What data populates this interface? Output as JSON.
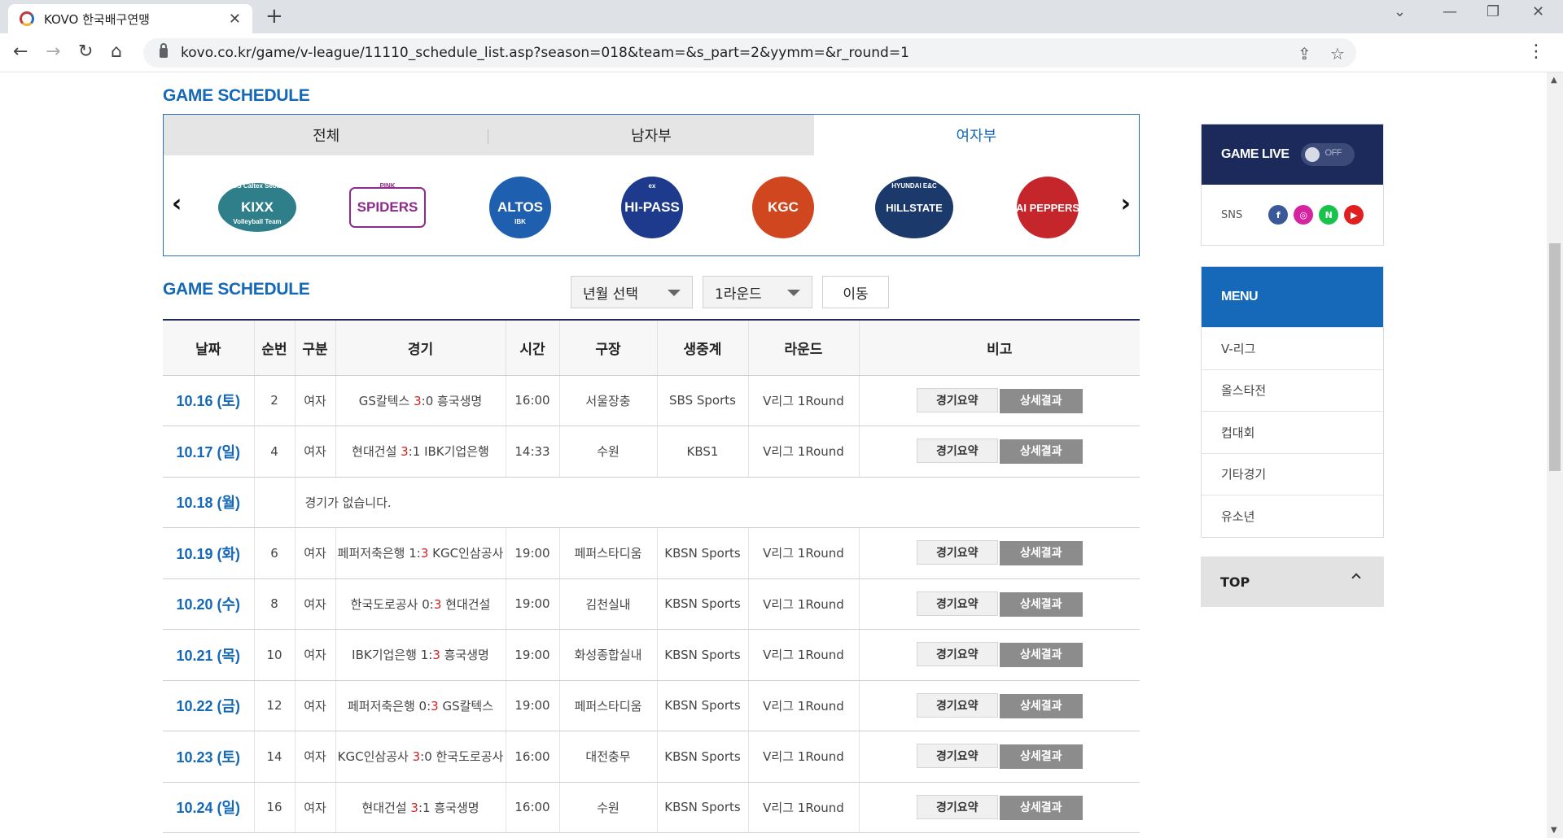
{
  "browser": {
    "tab_title": "KOVO 한국배구연맹",
    "url": "kovo.co.kr/game/v-league/11110_schedule_list.asp?season=018&team=&s_part=2&yymm=&r_round=1"
  },
  "team_section": {
    "title": "GAME SCHEDULE",
    "tabs": [
      "전체",
      "남자부",
      "여자부"
    ],
    "active_tab": "여자부",
    "teams": [
      {
        "line1": "GS Caltex Seoul",
        "line2": "KIXX",
        "line3": "Volleyball Team",
        "color": "#2f7f8a"
      },
      {
        "line1": "PINK",
        "line2": "SPIDERS",
        "line3": "",
        "color": "#8e2a8c"
      },
      {
        "line1": "",
        "line2": "ALTOS",
        "line3": "IBK",
        "color": "#1f5fb0"
      },
      {
        "line1": "ex",
        "line2": "HI-PASS",
        "line3": "",
        "color": "#1d3a8c"
      },
      {
        "line1": "",
        "line2": "KGC",
        "line3": "",
        "color": "#d0461f"
      },
      {
        "line1": "HYUNDAI E&C",
        "line2": "HILLSTATE",
        "line3": "",
        "color": "#1b3a6b"
      },
      {
        "line1": "",
        "line2": "AI PEPPERS",
        "line3": "",
        "color": "#c5262b"
      }
    ]
  },
  "schedule": {
    "title": "GAME SCHEDULE",
    "month_select": "년월 선택",
    "round_select": "1라운드",
    "go_button": "이동",
    "headers": [
      "날짜",
      "순번",
      "구분",
      "경기",
      "시간",
      "구장",
      "생중계",
      "라운드",
      "비고"
    ],
    "summary_label": "경기요약",
    "detail_label": "상세결과",
    "no_game_text": "경기가 없습니다.",
    "rows": [
      {
        "date": "10.16 (토)",
        "no": "2",
        "div": "여자",
        "home": "GS칼텍스",
        "hs": "3",
        "sep": ":",
        "as": "0",
        "away": "흥국생명",
        "win": "home",
        "time": "16:00",
        "venue": "서울장충",
        "tv": "SBS Sports",
        "round": "V리그 1Round"
      },
      {
        "date": "10.17 (일)",
        "no": "4",
        "div": "여자",
        "home": "현대건설",
        "hs": "3",
        "sep": ":",
        "as": "1",
        "away": "IBK기업은행",
        "win": "home",
        "time": "14:33",
        "venue": "수원",
        "tv": "KBS1",
        "round": "V리그 1Round"
      },
      {
        "date": "10.18 (월)",
        "nogame": true
      },
      {
        "date": "10.19 (화)",
        "no": "6",
        "div": "여자",
        "home": "페퍼저축은행",
        "hs": "1",
        "sep": ":",
        "as": "3",
        "away": "KGC인삼공사",
        "win": "away",
        "time": "19:00",
        "venue": "페퍼스타디움",
        "tv": "KBSN Sports",
        "round": "V리그 1Round"
      },
      {
        "date": "10.20 (수)",
        "no": "8",
        "div": "여자",
        "home": "한국도로공사",
        "hs": "0",
        "sep": ":",
        "as": "3",
        "away": "현대건설",
        "win": "away",
        "time": "19:00",
        "venue": "김천실내",
        "tv": "KBSN Sports",
        "round": "V리그 1Round"
      },
      {
        "date": "10.21 (목)",
        "no": "10",
        "div": "여자",
        "home": "IBK기업은행",
        "hs": "1",
        "sep": ":",
        "as": "3",
        "away": "흥국생명",
        "win": "away",
        "time": "19:00",
        "venue": "화성종합실내",
        "tv": "KBSN Sports",
        "round": "V리그 1Round"
      },
      {
        "date": "10.22 (금)",
        "no": "12",
        "div": "여자",
        "home": "페퍼저축은행",
        "hs": "0",
        "sep": ":",
        "as": "3",
        "away": "GS칼텍스",
        "win": "away",
        "time": "19:00",
        "venue": "페퍼스타디움",
        "tv": "KBSN Sports",
        "round": "V리그 1Round"
      },
      {
        "date": "10.23 (토)",
        "no": "14",
        "div": "여자",
        "home": "KGC인삼공사",
        "hs": "3",
        "sep": ":",
        "as": "0",
        "away": "한국도로공사",
        "win": "home",
        "time": "16:00",
        "venue": "대전충무",
        "tv": "KBSN Sports",
        "round": "V리그 1Round"
      },
      {
        "date": "10.24 (일)",
        "no": "16",
        "div": "여자",
        "home": "현대건설",
        "hs": "3",
        "sep": ":",
        "as": "1",
        "away": "흥국생명",
        "win": "home",
        "time": "16:00",
        "venue": "수원",
        "tv": "KBSN Sports",
        "round": "V리그 1Round"
      }
    ]
  },
  "sidebar": {
    "live_title": "GAME LIVE",
    "live_toggle": "OFF",
    "sns_label": "SNS",
    "sns": [
      {
        "icon": "facebook-icon",
        "glyph": "f",
        "color": "#3b5998"
      },
      {
        "icon": "instagram-icon",
        "glyph": "◎",
        "color": "#d6249f"
      },
      {
        "icon": "naver-icon",
        "glyph": "N",
        "color": "#19c24a"
      },
      {
        "icon": "youtube-icon",
        "glyph": "▶",
        "color": "#e02020"
      }
    ],
    "menu_title": "MENU",
    "menu_items": [
      "V-리그",
      "올스타전",
      "컵대회",
      "기타경기",
      "유소년"
    ],
    "top_label": "TOP"
  }
}
